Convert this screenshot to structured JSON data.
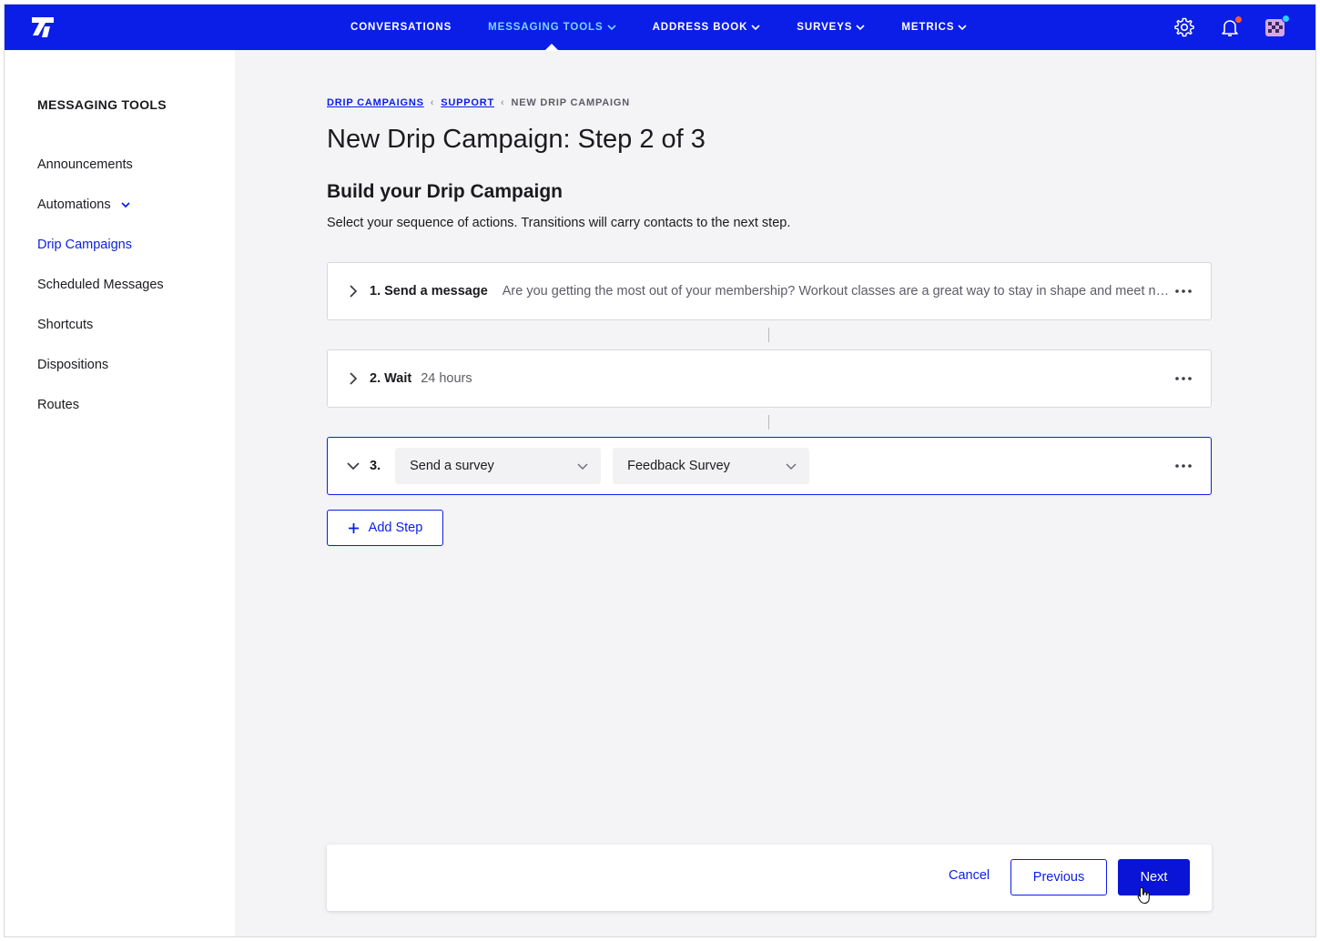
{
  "colors": {
    "brand": "#0a1ee8",
    "active_nav": "#7fd3ff",
    "page_bg": "#f4f4f7",
    "notify_dot": "#ff5a36",
    "avatar_dot": "#2ad3ff"
  },
  "nav": {
    "items": [
      {
        "label": "CONVERSATIONS",
        "has_dropdown": false,
        "active": false
      },
      {
        "label": "MESSAGING TOOLS",
        "has_dropdown": true,
        "active": true
      },
      {
        "label": "ADDRESS BOOK",
        "has_dropdown": true,
        "active": false
      },
      {
        "label": "SURVEYS",
        "has_dropdown": true,
        "active": false
      },
      {
        "label": "METRICS",
        "has_dropdown": true,
        "active": false
      }
    ],
    "icons": [
      "gear-icon",
      "bell-icon",
      "avatar"
    ]
  },
  "sidebar": {
    "title": "MESSAGING TOOLS",
    "items": [
      {
        "label": "Announcements"
      },
      {
        "label": "Automations"
      },
      {
        "label": "Drip Campaigns"
      },
      {
        "label": "Scheduled Messages"
      },
      {
        "label": "Shortcuts"
      },
      {
        "label": "Dispositions"
      },
      {
        "label": "Routes"
      }
    ]
  },
  "breadcrumb": {
    "items": [
      "DRIP CAMPAIGNS",
      "SUPPORT"
    ],
    "current": "NEW DRIP CAMPAIGN"
  },
  "page": {
    "title": "New Drip Campaign: Step 2 of 3",
    "section_title": "Build your Drip Campaign",
    "section_desc": "Select your sequence of actions. Transitions will carry contacts to the next step."
  },
  "steps": [
    {
      "label": "1. Send a message",
      "detail": "Are you getting the most out of your membership? Workout classes are a great way to stay in shape and meet new people!"
    },
    {
      "label": "2. Wait",
      "detail": "24 hours"
    },
    {
      "label": "3.",
      "action_select": "Send a survey",
      "survey_select": "Feedback Survey"
    }
  ],
  "add_step_label": "Add Step",
  "footer": {
    "cancel": "Cancel",
    "previous": "Previous",
    "next": "Next"
  }
}
